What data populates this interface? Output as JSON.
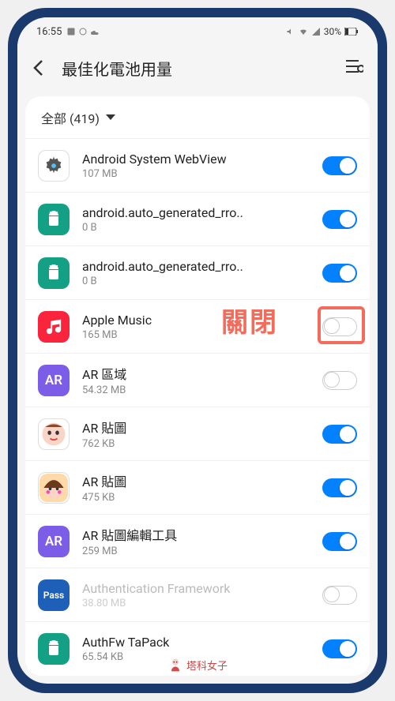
{
  "status": {
    "time": "16:55",
    "battery_text": "30%"
  },
  "header": {
    "title": "最佳化電池用量"
  },
  "filter": {
    "label": "全部 (419)"
  },
  "apps": [
    {
      "name": "Android System WebView",
      "size": "107 MB",
      "toggle": "on",
      "icon_bg": "#ffffff",
      "icon_type": "gear",
      "disabled": false
    },
    {
      "name": "android.auto_generated_rro..",
      "size": "0 B",
      "toggle": "on",
      "icon_bg": "#14a085",
      "icon_type": "android",
      "disabled": false
    },
    {
      "name": "android.auto_generated_rro..",
      "size": "0 B",
      "toggle": "on",
      "icon_bg": "#14a085",
      "icon_type": "android",
      "disabled": false
    },
    {
      "name": "Apple Music",
      "size": "165 MB",
      "toggle": "off",
      "icon_bg": "#fa243c",
      "icon_type": "music",
      "disabled": false,
      "highlight": true
    },
    {
      "name": "AR 區域",
      "size": "54.32 MB",
      "toggle": "off",
      "icon_bg": "#7c5de8",
      "icon_type": "ar",
      "disabled": false
    },
    {
      "name": "AR 貼圖",
      "size": "762 KB",
      "toggle": "on",
      "icon_bg": "#ffffff",
      "icon_type": "face1",
      "disabled": false
    },
    {
      "name": "AR 貼圖",
      "size": "475 KB",
      "toggle": "on",
      "icon_bg": "#ffffff",
      "icon_type": "face2",
      "disabled": false
    },
    {
      "name": "AR 貼圖編輯工具",
      "size": "259 MB",
      "toggle": "on",
      "icon_bg": "#7c5de8",
      "icon_type": "ar",
      "disabled": false
    },
    {
      "name": "Authentication Framework",
      "size": "38.80 MB",
      "toggle": "off",
      "icon_bg": "#1e5fb8",
      "icon_type": "pass",
      "disabled": true
    },
    {
      "name": "AuthFw TaPack",
      "size": "65.54 KB",
      "toggle": "on",
      "icon_bg": "#14a085",
      "icon_type": "android",
      "disabled": false
    }
  ],
  "annotation": {
    "text": "關閉"
  },
  "watermark": {
    "text": "塔科女子"
  }
}
